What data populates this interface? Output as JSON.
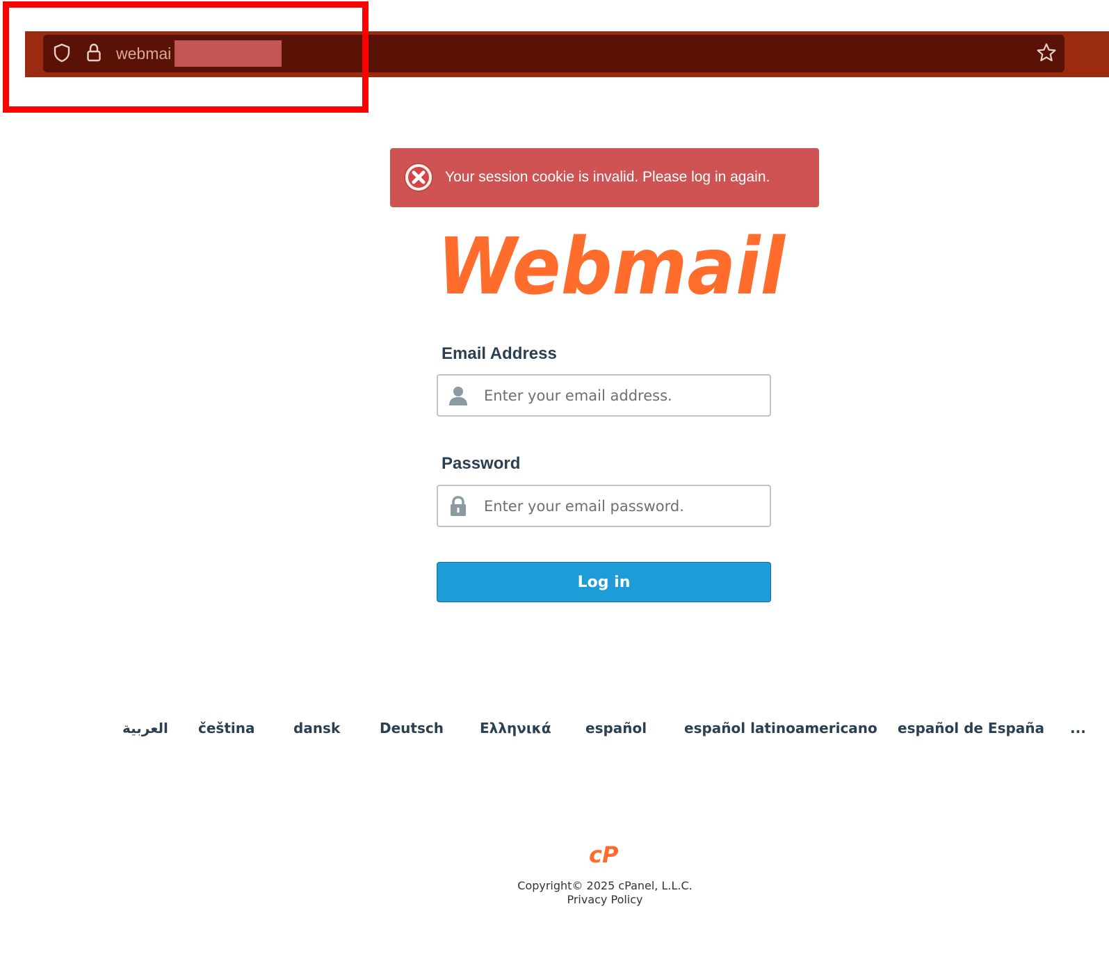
{
  "browser": {
    "url_text": "webmai",
    "icons": [
      "shield-icon",
      "lock-icon",
      "star-icon"
    ]
  },
  "alert": {
    "icon": "error-x-icon",
    "message": "Your session cookie is invalid. Please log in again."
  },
  "logo": {
    "text": "Webmail",
    "color": "#ff6c2c"
  },
  "form": {
    "email_label": "Email Address",
    "email_placeholder": "Enter your email address.",
    "email_icon": "user-icon",
    "password_label": "Password",
    "password_placeholder": "Enter your email password.",
    "password_icon": "lock-icon",
    "login_label": "Log in"
  },
  "languages": [
    "العربية",
    "čeština",
    "dansk",
    "Deutsch",
    "Ελληνικά",
    "español",
    "español latinoamericano",
    "español de España",
    "..."
  ],
  "footer": {
    "logo_text": "cP",
    "copyright": "Copyright© 2025 cPanel, L.L.C.",
    "privacy": "Privacy Policy"
  },
  "colors": {
    "browser_bar": "#9a2a10",
    "url_bar": "#5a1106",
    "alert_bg": "#d05353",
    "button": "#1e9cd8",
    "highlight": "#ff0000",
    "brand_orange": "#ff6c2c"
  }
}
